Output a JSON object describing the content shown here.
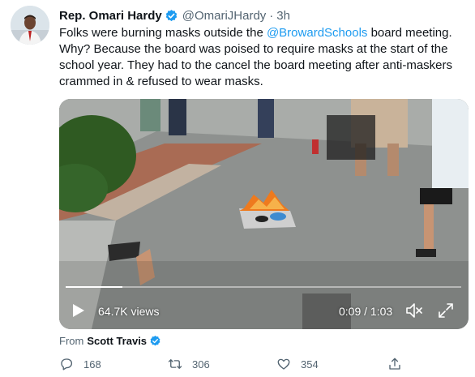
{
  "tweet": {
    "author": {
      "display_name": "Rep. Omari Hardy",
      "handle": "@OmariJHardy",
      "verified": true
    },
    "separator": "·",
    "time": "3h",
    "text": {
      "part1": "Folks were burning masks outside the ",
      "mention": "@BrowardSchools",
      "part2": " board meeting. Why? Because the board was poised to require masks at the start of the school year. They had to the cancel the board meeting after anti-maskers crammed in & refused to wear masks."
    },
    "video": {
      "views": "64.7K views",
      "time_display": "0:09 / 1:03",
      "progress_fraction": 0.143,
      "play_icon": "play-icon",
      "mute_icon": "muted-speaker-icon",
      "fullscreen_icon": "fullscreen-icon"
    },
    "source": {
      "prefix": "From",
      "name": "Scott Travis",
      "verified": true
    },
    "actions": {
      "reply_count": "168",
      "retweet_count": "306",
      "like_count": "354",
      "share_icon": "share-icon"
    }
  },
  "colors": {
    "accent": "#1d9bf0",
    "text_primary": "#0f1419",
    "text_secondary": "#536471"
  }
}
